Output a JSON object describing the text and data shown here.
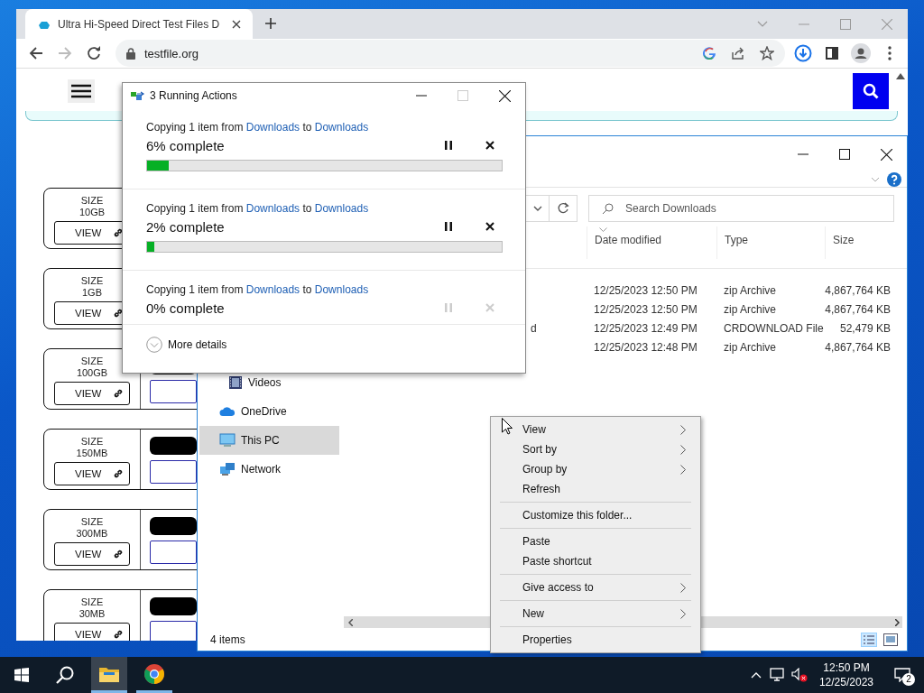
{
  "browser": {
    "tab_title": "Ultra Hi-Speed Direct Test Files D",
    "url": "testfile.org",
    "nav_buttons": [
      {
        "kind": "back",
        "enabled": true
      },
      {
        "kind": "forward",
        "enabled": false
      },
      {
        "kind": "reload",
        "enabled": true
      }
    ],
    "cards": [
      {
        "label": "SIZE",
        "value": "10GB",
        "button": "VIEW"
      },
      {
        "label": "SIZE",
        "value": "1GB",
        "button": "VIEW"
      },
      {
        "label": "SIZE",
        "value": "100GB",
        "button": "VIEW"
      },
      {
        "label": "SIZE",
        "value": "150MB",
        "button": "VIEW"
      },
      {
        "label": "SIZE",
        "value": "300MB",
        "button": "VIEW"
      },
      {
        "label": "SIZE",
        "value": "30MB",
        "button": "VIEW"
      }
    ]
  },
  "explorer": {
    "search_placeholder": "Search Downloads",
    "columns": [
      "Date modified",
      "Type",
      "Size"
    ],
    "rows": [
      {
        "date": "12/25/2023 12:50 PM",
        "type": "zip Archive",
        "size": "4,867,764 KB"
      },
      {
        "date": "12/25/2023 12:50 PM",
        "type": "zip Archive",
        "size": "4,867,764 KB"
      },
      {
        "name": "d",
        "date": "12/25/2023 12:49 PM",
        "type": "CRDOWNLOAD File",
        "size": "52,479 KB"
      },
      {
        "date": "12/25/2023 12:48 PM",
        "type": "zip Archive",
        "size": "4,867,764 KB"
      }
    ],
    "nav": [
      {
        "kind": "videos",
        "label": "Videos",
        "selected": false
      },
      {
        "kind": "onedrive",
        "label": "OneDrive",
        "selected": false
      },
      {
        "kind": "pc",
        "label": "This PC",
        "selected": true
      },
      {
        "kind": "network",
        "label": "Network",
        "selected": false
      }
    ],
    "status": "4 items"
  },
  "dialog": {
    "title": "3 Running Actions",
    "operations": [
      {
        "verb": "Copying 1 item from",
        "source": "Downloads",
        "joiner": "to",
        "destination": "Downloads",
        "progress": "6% complete",
        "level": 0.06,
        "controls_enabled": true
      },
      {
        "verb": "Copying 1 item from",
        "source": "Downloads",
        "joiner": "to",
        "destination": "Downloads",
        "progress": "2% complete",
        "level": 0.02,
        "controls_enabled": true
      },
      {
        "verb": "Copying 1 item from",
        "source": "Downloads",
        "joiner": "to",
        "destination": "Downloads",
        "progress": "0% complete",
        "controls_enabled": false
      }
    ],
    "more": "More details"
  },
  "context_menu": [
    {
      "kind": "item",
      "label": "View",
      "submenu": true
    },
    {
      "kind": "item",
      "label": "Sort by",
      "submenu": true
    },
    {
      "kind": "item",
      "label": "Group by",
      "submenu": true
    },
    {
      "kind": "item",
      "label": "Refresh",
      "submenu": false
    },
    {
      "kind": "separator"
    },
    {
      "kind": "item",
      "label": "Customize this folder...",
      "submenu": false
    },
    {
      "kind": "separator"
    },
    {
      "kind": "item",
      "label": "Paste",
      "submenu": false
    },
    {
      "kind": "item",
      "label": "Paste shortcut",
      "submenu": false
    },
    {
      "kind": "separator"
    },
    {
      "kind": "item",
      "label": "Give access to",
      "submenu": true
    },
    {
      "kind": "separator"
    },
    {
      "kind": "item",
      "label": "New",
      "submenu": true
    },
    {
      "kind": "separator"
    },
    {
      "kind": "item",
      "label": "Properties",
      "submenu": false
    }
  ],
  "taskbar": {
    "apps": [
      {
        "kind": "explorer",
        "focused": true
      },
      {
        "kind": "chrome",
        "focused": false
      }
    ],
    "time": "12:50 PM",
    "date": "12/25/2023",
    "notifications": "2"
  }
}
